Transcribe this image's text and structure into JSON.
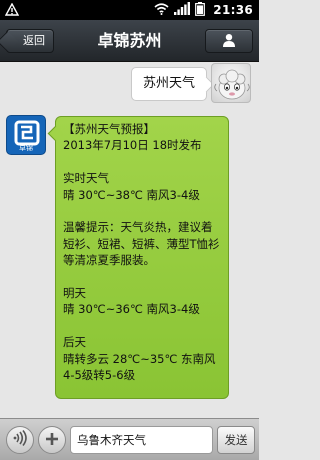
{
  "status_bar": {
    "time": "21:36",
    "icons": [
      "notification-icon",
      "wifi-icon",
      "signal-icon",
      "battery-icon"
    ]
  },
  "header": {
    "back_label": "返回",
    "title": "卓锦苏州",
    "profile_icon": "person-icon"
  },
  "chat": {
    "outgoing": {
      "text": "苏州天气"
    },
    "incoming": {
      "bot_avatar_label": "卓锦",
      "text": "【苏州天气预报】\n2013年7月10日 18时发布\n\n实时天气\n晴 30℃~38℃ 南风3-4级\n\n温馨提示：天气炎热，建议着短衫、短裙、短裤、薄型T恤衫等清凉夏季服装。\n\n明天\n晴 30℃~36℃ 南风3-4级\n\n后天\n晴转多云 28℃~35℃ 东南风4-5级转5-6级"
    }
  },
  "input_bar": {
    "input_value": "乌鲁木齐天气",
    "send_label": "发送"
  },
  "colors": {
    "incoming_bubble": "#96cc3e",
    "title_bar": "#2f3439",
    "bot_avatar": "#1565b8"
  }
}
